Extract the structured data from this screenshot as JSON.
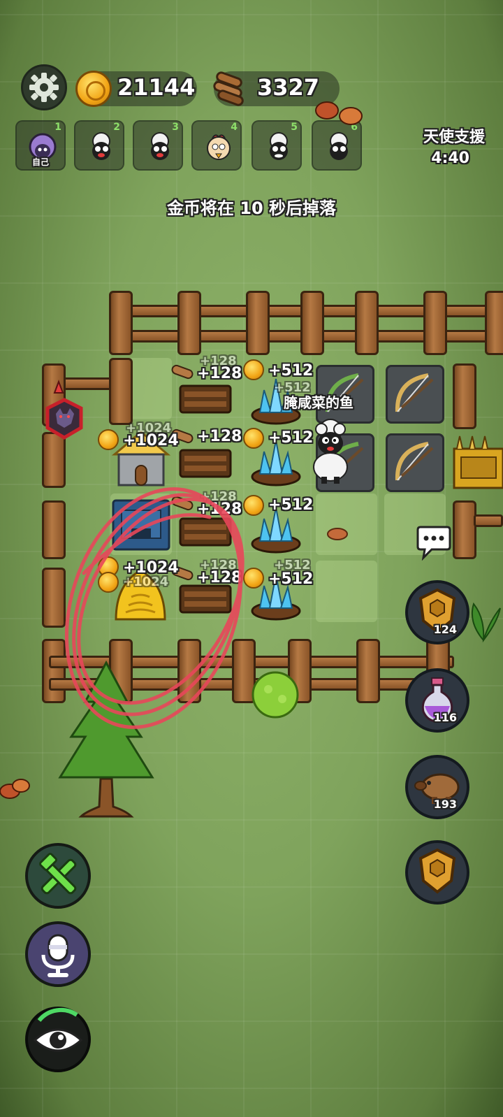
{
  "resources": {
    "coins": "21144",
    "wood": "3327"
  },
  "players": [
    {
      "num": "1",
      "label": "自己",
      "kind": "self"
    },
    {
      "num": "2",
      "label": "",
      "kind": "sheep"
    },
    {
      "num": "3",
      "label": "",
      "kind": "sheep"
    },
    {
      "num": "4",
      "label": "",
      "kind": "rooster"
    },
    {
      "num": "5",
      "label": "",
      "kind": "sheep"
    },
    {
      "num": "6",
      "label": "",
      "kind": "sheep"
    }
  ],
  "angel_support": {
    "title": "天使支援",
    "time": "4:40"
  },
  "coin_drop_message": "金币将在 10 秒后掉落",
  "board": {
    "gains": {
      "wood_128": "+128",
      "crystal_512": "+512",
      "house_1024": "+1024"
    },
    "player_name": "腌咸菜的鱼"
  },
  "side_buttons": {
    "shield_count": "124",
    "potion_count": "116",
    "piggy_count": "193"
  },
  "colors": {
    "accent_green": "#8ee06a",
    "annotation_red": "#e8475a",
    "panel_dark": "#2e3640"
  },
  "icons": {
    "settings": "gear-icon",
    "coin": "coin-icon",
    "wood": "wood-log-icon",
    "tools": "hammer-wrench-icon",
    "mic": "microphone-icon",
    "view": "eye-icon",
    "chat": "chat-bubble-icon",
    "shield": "shield-icon",
    "potion": "potion-icon",
    "piggy": "piggy-bank-icon"
  }
}
